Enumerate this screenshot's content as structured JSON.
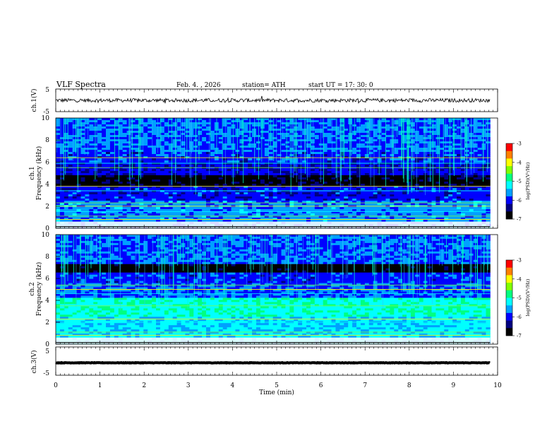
{
  "header": {
    "title": "VLF  Spectra",
    "date": "Feb. 4. , 2026",
    "station": "station= ATH",
    "start_ut": "start  UT  =    17: 30: 0"
  },
  "chart_data": [
    {
      "type": "line",
      "panel": "ch1-waveform",
      "ylabel": "ch.1(V)",
      "ylim": [
        -5,
        5
      ],
      "yticks": [
        "5",
        "-5"
      ],
      "xlim": [
        0,
        9.83
      ],
      "baseline": 0,
      "amplitude": 0.7
    },
    {
      "type": "heatmap",
      "panel": "ch1-spectrogram",
      "ylabel": "ch.1\nFrequency  (kHz)",
      "ylim": [
        0,
        10
      ],
      "yticks": [
        "0",
        "2",
        "4",
        "6",
        "8",
        "10"
      ],
      "xlim": [
        0,
        9.83
      ],
      "colorbar": {
        "label": "log(PSD)(V²/Hz)",
        "range": [
          -7,
          -3
        ],
        "ticks": [
          "-3",
          "-4",
          "-5",
          "-6",
          "-7"
        ]
      },
      "emission_lines_khz": [
        0.8,
        1.1,
        1.5,
        2.0,
        2.3,
        3.4,
        3.8,
        5.5,
        5.9,
        6.4
      ],
      "dark_band_khz": [
        3.8,
        4.9
      ]
    },
    {
      "type": "heatmap",
      "panel": "ch2-spectrogram",
      "ylabel": "ch.2\nFrequency  (kHz)",
      "ylim": [
        0,
        10
      ],
      "yticks": [
        "0",
        "2",
        "4",
        "6",
        "8",
        "10"
      ],
      "xlim": [
        0,
        9.83
      ],
      "colorbar": {
        "label": "log(PSD)(V²/Hz)",
        "range": [
          -7,
          -3
        ],
        "ticks": [
          "-3",
          "-4",
          "-5",
          "-6",
          "-7"
        ]
      },
      "emission_lines_khz": [
        0.8,
        1.1,
        2.0,
        2.3,
        3.5,
        4.6,
        5.0,
        5.4
      ],
      "dark_band_khz": [
        6.6,
        7.3
      ]
    },
    {
      "type": "line",
      "panel": "ch3-waveform",
      "ylabel": "ch.3(V)",
      "ylim": [
        -5,
        5
      ],
      "yticks": [
        "5",
        "-5"
      ],
      "xlim": [
        0,
        9.83
      ],
      "baseline": -0.6,
      "amplitude": 0.15
    }
  ],
  "xaxis": {
    "label": "Time  (min)",
    "ticks": [
      "0",
      "1",
      "2",
      "3",
      "4",
      "5",
      "6",
      "7",
      "8",
      "9",
      "10"
    ],
    "xlim": [
      0,
      10
    ]
  },
  "colors": {
    "background": "#ffffff",
    "axes": "#000000",
    "colormap": [
      "#000000",
      "#000080",
      "#0000ff",
      "#00a0ff",
      "#00ffff",
      "#00ff80",
      "#80ff00",
      "#ffff00",
      "#ff8000",
      "#ff0000",
      "#ffffff"
    ]
  }
}
